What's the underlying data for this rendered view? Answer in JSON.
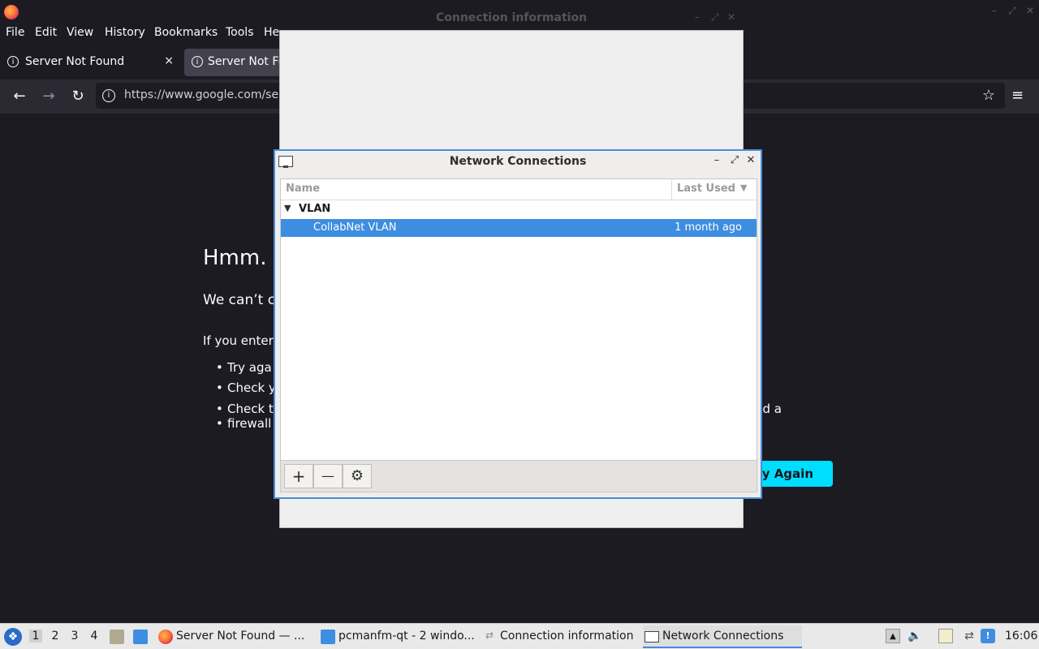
{
  "firefox": {
    "menu": [
      "File",
      "Edit",
      "View",
      "History",
      "Bookmarks",
      "Tools",
      "He"
    ],
    "tabs": [
      {
        "label": "Server Not Found",
        "close": "×"
      },
      {
        "label": "Server Not Fo"
      }
    ],
    "url": "https://www.google.com/se",
    "error_page": {
      "title": "Hmm.",
      "message": "We can’t c",
      "hint": "If you enter",
      "bullets": [
        "Try aga",
        "Check y",
        "Check t"
      ],
      "bullet_continuation": "firewall",
      "extra_text": "nd a",
      "try_again_label": "y Again"
    }
  },
  "connection_info_window": {
    "title": "Connection information"
  },
  "network_connections_window": {
    "title": "Network Connections",
    "columns": {
      "name": "Name",
      "last_used": "Last Used"
    },
    "group": "VLAN",
    "connections": [
      {
        "name": "CollabNet VLAN",
        "last_used": "1 month ago",
        "selected": true
      }
    ],
    "toolbar": {
      "add": "+",
      "remove": "—",
      "settings": "⚙"
    }
  },
  "taskbar": {
    "workspaces": [
      "1",
      "2",
      "3",
      "4"
    ],
    "active_workspace": "1",
    "tasks": [
      {
        "label": "Server Not Found — ..."
      },
      {
        "label": "pcmanfm-qt - 2 windo..."
      },
      {
        "label": "Connection information"
      },
      {
        "label": "Network Connections",
        "active": true
      }
    ],
    "clock": "16:06"
  },
  "colors": {
    "accent": "#3d8ee0",
    "firefox_bg": "#1c1b22",
    "try_again": "#00ddff"
  }
}
